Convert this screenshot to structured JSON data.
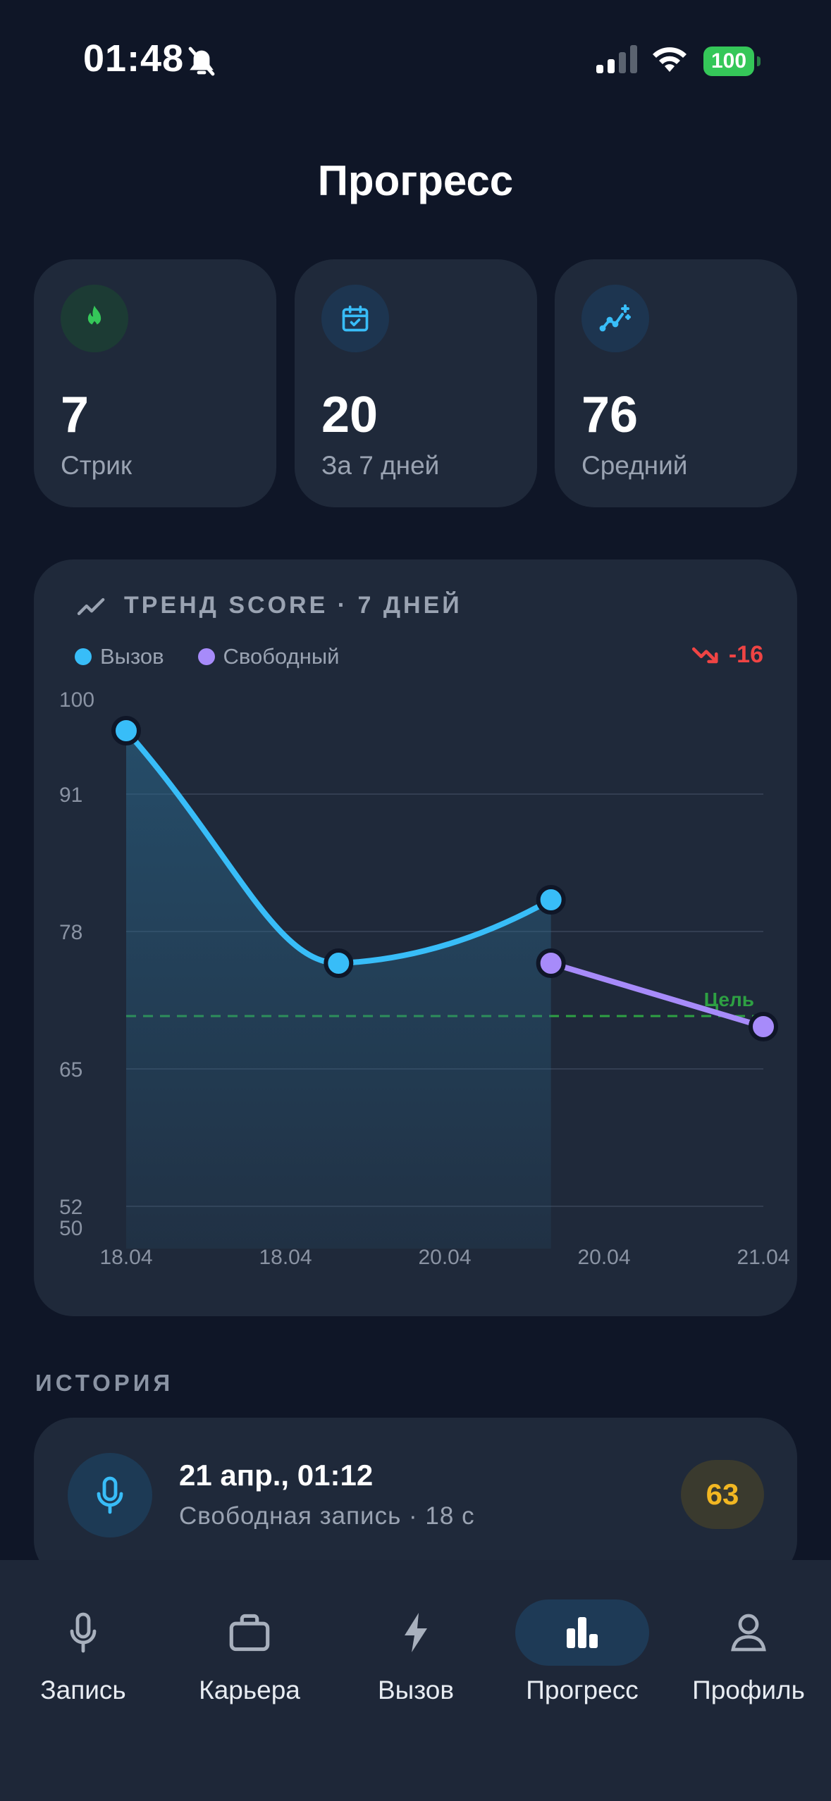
{
  "status_bar": {
    "time": "01:48",
    "battery": "100"
  },
  "page_title": "Прогресс",
  "stats": [
    {
      "icon": "flame-icon",
      "value": "7",
      "label": "Стрик",
      "color": "#35c759"
    },
    {
      "icon": "calendar-check-icon",
      "value": "20",
      "label": "За 7 дней",
      "color": "#38bdf8"
    },
    {
      "icon": "sparkle-chart-icon",
      "value": "76",
      "label": "Средний",
      "color": "#38bdf8"
    }
  ],
  "trend": {
    "title": "ТРЕНД SCORE · 7 ДНЕЙ",
    "legend": [
      {
        "name": "Вызов",
        "color": "#38bdf8"
      },
      {
        "name": "Свободный",
        "color": "#a78bfa"
      }
    ],
    "delta": "-16",
    "goal_label": "Цель"
  },
  "chart_data": {
    "type": "line",
    "title": "ТРЕНД SCORE · 7 ДНЕЙ",
    "x_labels": [
      "18.04",
      "18.04",
      "20.04",
      "20.04",
      "21.04"
    ],
    "y_ticks": [
      100,
      91,
      78,
      65,
      52,
      50
    ],
    "ylim": [
      50,
      100
    ],
    "goal": 70,
    "grid": true,
    "legend_position": "top-left",
    "series": [
      {
        "name": "Вызов",
        "color": "#38bdf8",
        "points": [
          {
            "x": 0,
            "y": 97
          },
          {
            "x": 2,
            "y": 75
          },
          {
            "x": 4,
            "y": 81
          }
        ]
      },
      {
        "name": "Свободный",
        "color": "#a78bfa",
        "points": [
          {
            "x": 4,
            "y": 75
          },
          {
            "x": 6,
            "y": 69
          }
        ]
      }
    ]
  },
  "history": {
    "section_title": "ИСТОРИЯ",
    "items": [
      {
        "title": "21 апр., 01:12",
        "subtitle": "Свободная запись · 18 с",
        "score": "63"
      }
    ]
  },
  "tabs": [
    {
      "label": "Запись",
      "icon": "mic-icon",
      "active": false
    },
    {
      "label": "Карьера",
      "icon": "briefcase-icon",
      "active": false
    },
    {
      "label": "Вызов",
      "icon": "bolt-icon",
      "active": false
    },
    {
      "label": "Прогресс",
      "icon": "bar-chart-icon",
      "active": true
    },
    {
      "label": "Профиль",
      "icon": "person-icon",
      "active": false
    }
  ]
}
